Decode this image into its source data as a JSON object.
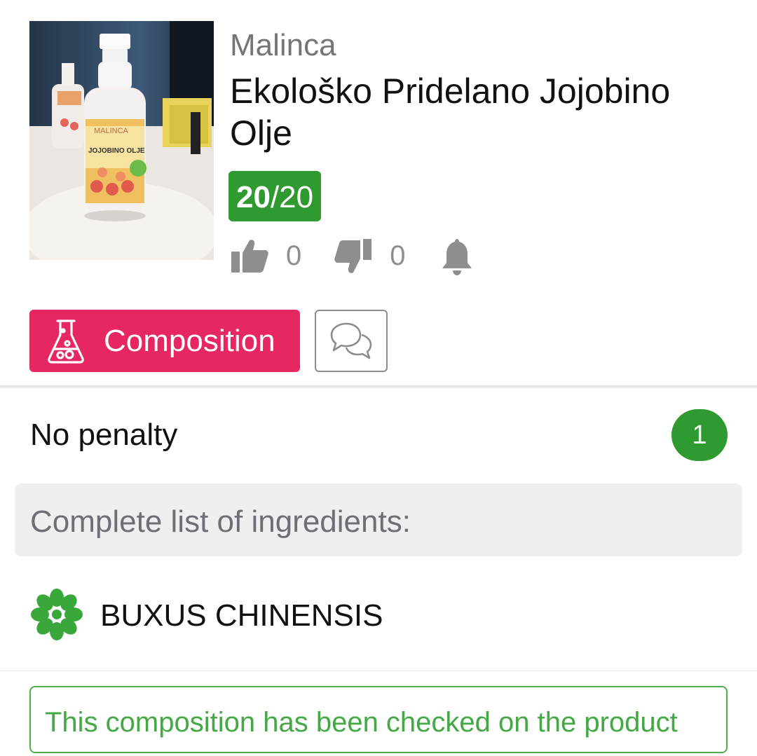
{
  "product": {
    "brand": "Malinca",
    "title": "Ekološko Pridelano Jojobino Olje",
    "score_value": "20",
    "score_total": "/20",
    "photo_icon": "product-photo-spray-bottle"
  },
  "votes": {
    "likes": "0",
    "dislikes": "0",
    "like_icon": "thumbs-up-icon",
    "dislike_icon": "thumbs-down-icon",
    "notify_icon": "bell-icon"
  },
  "actions": {
    "composition_label": "Composition",
    "composition_icon": "flask-icon",
    "comments_icon": "chat-bubbles-icon"
  },
  "composition": {
    "penalty_label": "No penalty",
    "penalty_count": "1",
    "ingredients_header": "Complete list of ingredients:",
    "ingredients": [
      {
        "name": "BUXUS CHINENSIS",
        "icon": "green-flower-icon"
      }
    ],
    "checked_note": "This composition has been checked on the product"
  },
  "colors": {
    "accent_pink": "#e62762",
    "score_green": "#2f9a2f",
    "note_green": "#44a844",
    "icon_gray": "#8e8e8e"
  }
}
